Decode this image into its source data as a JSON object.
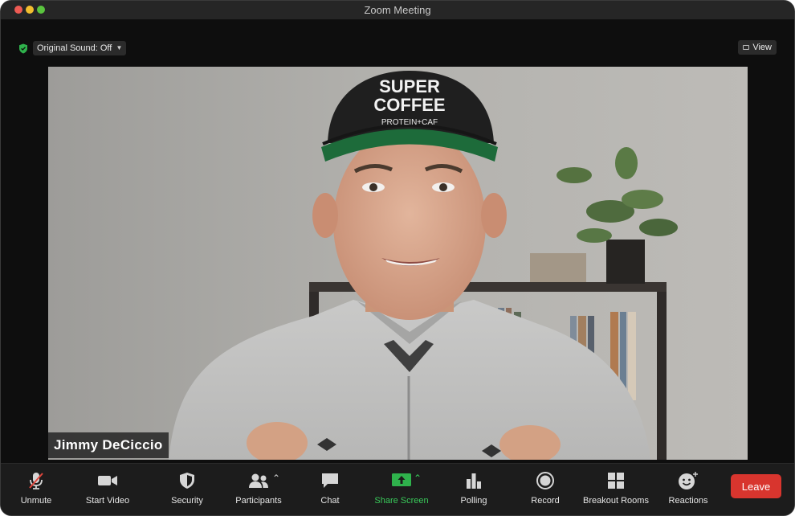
{
  "window": {
    "title": "Zoom Meeting"
  },
  "top_bar": {
    "original_sound_label": "Original Sound: Off",
    "view_label": "View"
  },
  "video": {
    "participant_name": "Jimmy DeCiccio",
    "cap_text_line1": "SUPER",
    "cap_text_line2": "COFFEE",
    "cap_text_line3": "PROTEIN+CAF"
  },
  "toolbar": {
    "unmute": "Unmute",
    "start_video": "Start Video",
    "security": "Security",
    "participants": "Participants",
    "chat": "Chat",
    "share_screen": "Share Screen",
    "polling": "Polling",
    "record": "Record",
    "breakout_rooms": "Breakout Rooms",
    "reactions": "Reactions",
    "leave": "Leave"
  },
  "colors": {
    "leave_red": "#d8352e",
    "share_green": "#39c95a",
    "mute_slash": "#e0463c"
  }
}
